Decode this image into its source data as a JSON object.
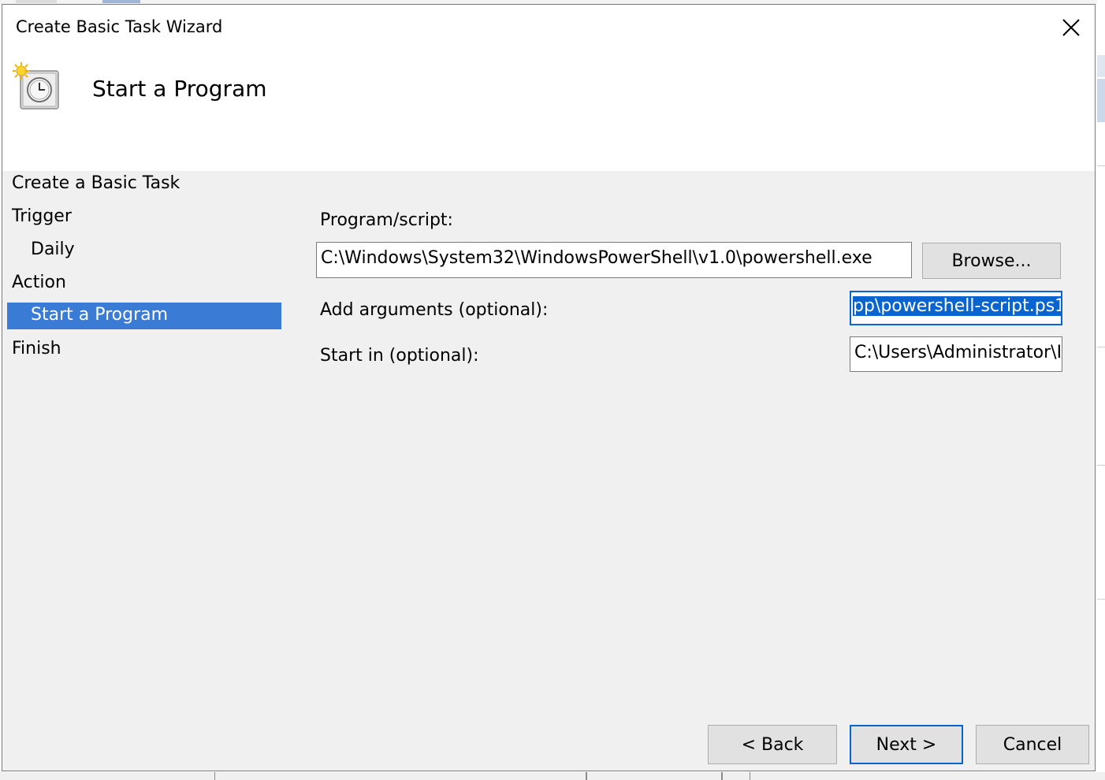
{
  "window": {
    "title": "Create Basic Task Wizard",
    "close_glyph": "✕"
  },
  "header": {
    "title": "Start a Program",
    "icon": "task-scheduler-clock-icon"
  },
  "steps": [
    {
      "label": "Create a Basic Task",
      "indent": false,
      "active": false
    },
    {
      "label": "Trigger",
      "indent": false,
      "active": false
    },
    {
      "label": "Daily",
      "indent": true,
      "active": false
    },
    {
      "label": "Action",
      "indent": false,
      "active": false
    },
    {
      "label": "Start a Program",
      "indent": true,
      "active": true
    },
    {
      "label": "Finish",
      "indent": false,
      "active": false
    }
  ],
  "form": {
    "program_label": "Program/script:",
    "program_value": "C:\\Windows\\System32\\WindowsPowerShell\\v1.0\\powershell.exe",
    "browse_label": "Browse...",
    "arguments_label": "Add arguments (optional):",
    "arguments_value": "pp\\powershell-script.ps1",
    "start_in_label": "Start in (optional):",
    "start_in_value": "C:\\Users\\Administrator\\I"
  },
  "buttons": {
    "back": "< Back",
    "next": "Next >",
    "cancel": "Cancel"
  },
  "colors": {
    "selection": "#3a7bd5",
    "focus_border": "#0a64d0",
    "dialog_bg": "#f0f0f0"
  }
}
